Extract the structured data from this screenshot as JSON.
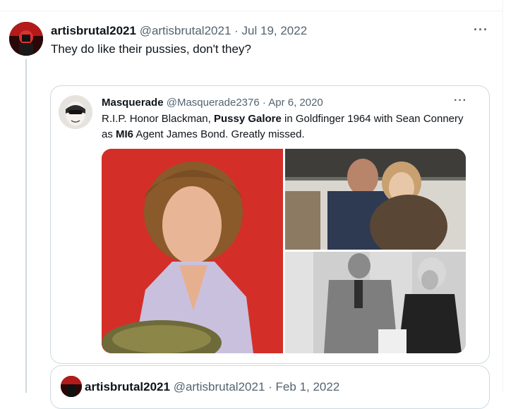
{
  "tweet": {
    "name": "artisbrutal2021",
    "handle": "@artisbrutal2021",
    "separator": "·",
    "date": "Jul 19, 2022",
    "more": "···",
    "text": "They do like their pussies, don't they?"
  },
  "quote": {
    "name": "Masquerade",
    "handle": "@Masquerade2376",
    "separator": "·",
    "date": "Apr 6, 2020",
    "more": "···",
    "text_parts": {
      "p1": "R.I.P. Honor Blackman, ",
      "b1": "Pussy Galore",
      "p2": " in Goldfinger 1964 with Sean Connery as ",
      "b2": "MI6",
      "p3": " Agent James Bond. Greatly missed."
    }
  },
  "next_quote": {
    "name": "artisbrutal2021",
    "handle": "@artisbrutal2021",
    "separator": "·",
    "date": "Feb 1, 2022"
  },
  "icons": {
    "more": "more-horizontal-icon"
  },
  "colors": {
    "text_primary": "#0f1419",
    "text_secondary": "#536471",
    "border": "#cfd9de",
    "thread_line": "#cfd9de"
  }
}
